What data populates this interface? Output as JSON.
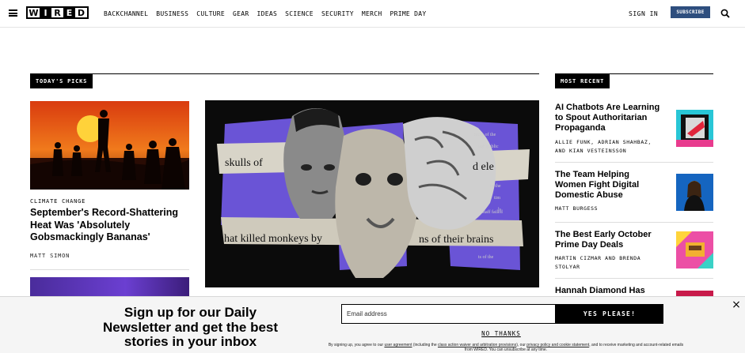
{
  "header": {
    "logo_letters": [
      "W",
      "I",
      "R",
      "E",
      "D"
    ],
    "nav": [
      "BACKCHANNEL",
      "BUSINESS",
      "CULTURE",
      "GEAR",
      "IDEAS",
      "SCIENCE",
      "SECURITY",
      "MERCH",
      "PRIME DAY"
    ],
    "sign_in": "SIGN IN",
    "subscribe": "SUBSCRIBE",
    "subscribe_color": "#2e4e7e"
  },
  "todays_picks": {
    "label": "TODAY'S PICKS",
    "story": {
      "kicker": "CLIMATE CHANGE",
      "headline": "September's Record-Shattering Heat Was 'Absolutely Gobsmackingly Bananas'",
      "byline": "MATT SIMON"
    },
    "hero_text": {
      "line1": "skulls of",
      "line2": "d ele",
      "line3": "hat killed monkeys by",
      "line4": "ns of their brains",
      "small1": "ieces of the",
      "small2": "ugh public",
      "small3": "in the",
      "small4": "tim",
      "small5": "ls",
      "small6": "staff failed",
      "small7": "ts of the"
    }
  },
  "most_recent": {
    "label": "MOST RECENT",
    "items": [
      {
        "title": "AI Chatbots Are Learning to Spout Authoritarian Propaganda",
        "byline": "ALLIE FUNK, ADRIAN SHAHBAZ, AND KIAN VESTEINSSON"
      },
      {
        "title": "The Team Helping Women Fight Digital Domestic Abuse",
        "byline": "MATT BURGESS"
      },
      {
        "title": "The Best Early October Prime Day Deals",
        "byline": "MARTIN CIZMAR AND BRENDA STOLYAR"
      },
      {
        "title": "Hannah Diamond Has",
        "byline": ""
      }
    ]
  },
  "newsletter": {
    "title": "Sign up for our Daily Newsletter and get the best stories in your inbox",
    "email_placeholder": "Email address",
    "cta": "YES PLEASE!",
    "no_thanks": "NO THANKS",
    "legal_1": "By signing up, you agree to our",
    "legal_link1": "user agreement",
    "legal_2": "(including the",
    "legal_link2": "class action waiver and arbitration provisions",
    "legal_3": "), our",
    "legal_link3": "privacy policy and cookie statement",
    "legal_4": ", and to receive marketing and account-related emails from WIRED. You can unsubscribe at any time.",
    "close": "×"
  }
}
